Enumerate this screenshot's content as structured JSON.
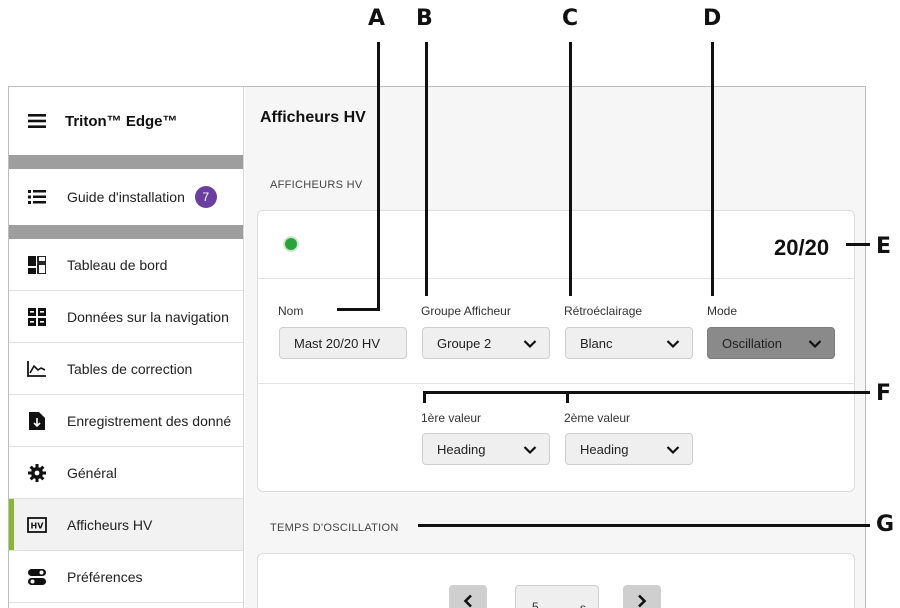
{
  "callouts": [
    "A",
    "B",
    "C",
    "D",
    "E",
    "F",
    "G"
  ],
  "sidebar": {
    "app_title": "Triton™ Edge™",
    "setup": {
      "label": "Guide d'installation",
      "badge": "7"
    },
    "items": [
      {
        "label": "Tableau de bord",
        "icon": "dashboard-icon"
      },
      {
        "label": "Données sur la navigation",
        "icon": "nav-data-icon"
      },
      {
        "label": "Tables de correction",
        "icon": "correction-table-icon"
      },
      {
        "label": "Enregistrement des donné",
        "icon": "data-logging-icon"
      },
      {
        "label": "Général",
        "icon": "gear-icon"
      },
      {
        "label": "Afficheurs HV",
        "icon": "hv-icon",
        "active": true
      },
      {
        "label": "Préférences",
        "icon": "toggles-icon"
      }
    ]
  },
  "main": {
    "title": "Afficheurs HV",
    "section1": "AFFICHEURS HV",
    "card": {
      "ratio": "20/20",
      "status_color": "#2aa33a",
      "fields": {
        "nom": {
          "label": "Nom",
          "value": "Mast 20/20 HV"
        },
        "groupe": {
          "label": "Groupe Afficheur",
          "value": "Groupe 2"
        },
        "retro": {
          "label": "Rétroéclairage",
          "value": "Blanc"
        },
        "mode": {
          "label": "Mode",
          "value": "Oscillation"
        },
        "val1": {
          "label": "1ère valeur",
          "value": "Heading"
        },
        "val2": {
          "label": "2ème valeur",
          "value": "Heading"
        }
      }
    },
    "section2": "TEMPS D'OSCILLATION",
    "stepper": {
      "value": "5",
      "unit": "s"
    }
  },
  "colors": {
    "accent": "#8bb53a",
    "badge": "#6b3fa0",
    "status": "#2aa33a"
  }
}
